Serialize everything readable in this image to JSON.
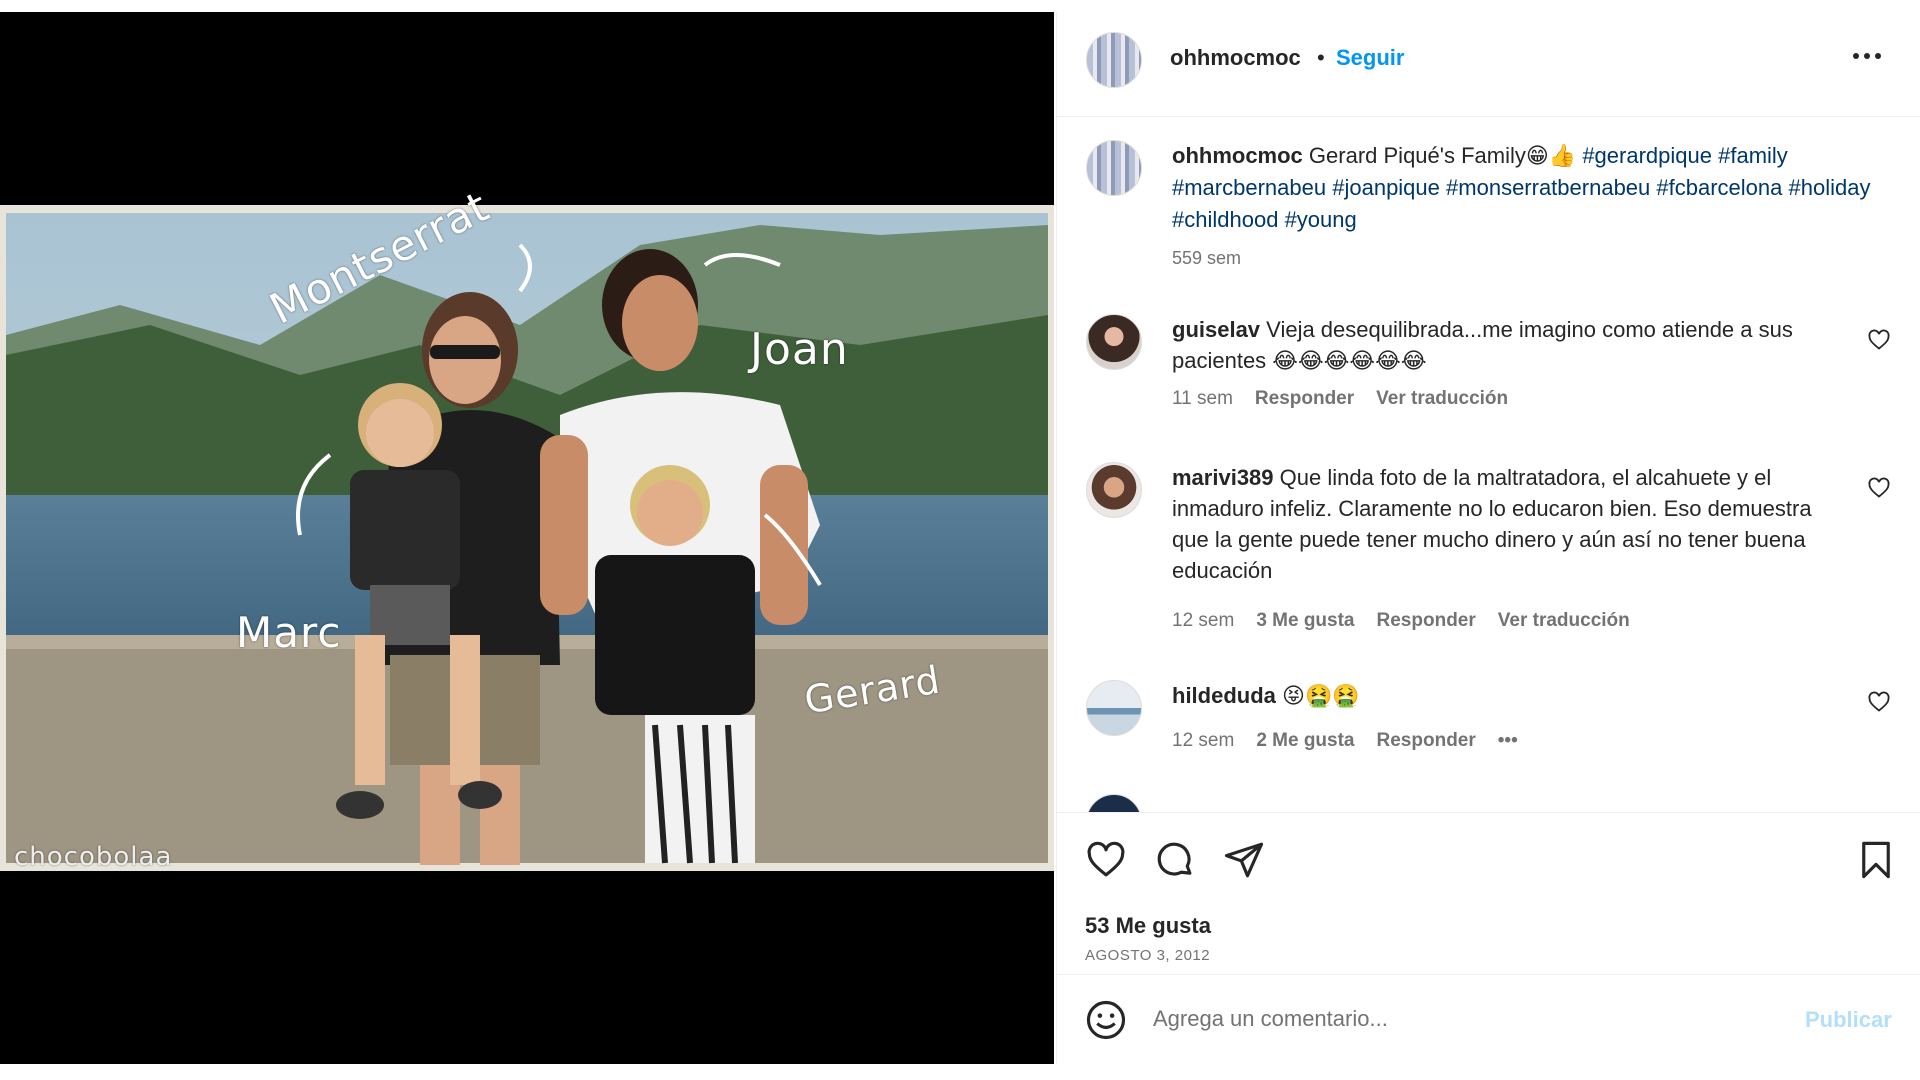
{
  "post": {
    "username": "ohhmocmoc",
    "dot": "•",
    "follow_label": "Seguir",
    "more_icon": "more-horizontal-icon"
  },
  "photo": {
    "labels": {
      "montserrat": "Montserrat",
      "joan": "Joan",
      "marc": "Marc",
      "gerard": "Gerard"
    },
    "watermark": "chocobolaa"
  },
  "caption": {
    "username": "ohhmocmoc",
    "text": "Gerard Piqué's Family😁👍",
    "hashtags": [
      "#gerardpique",
      "#family",
      "#marcbernabeu",
      "#joanpique",
      "#monserratbernabeu",
      "#fcbarcelona",
      "#holiday",
      "#childhood",
      "#young"
    ],
    "time": "559 sem"
  },
  "comments": [
    {
      "username": "guiselav",
      "text": "Vieja desequilibrada...me imagino como atiende a sus pacientes 😂😂😂😂😂😂",
      "time": "11 sem",
      "reply": "Responder",
      "translate": "Ver traducción"
    },
    {
      "username": "marivi389",
      "text": "Que linda foto de la maltratadora, el alcahuete y el inmaduro infeliz. Claramente no lo educaron bien. Eso demuestra que la gente puede tener mucho dinero y aún así no tener buena educación",
      "time": "12 sem",
      "likes": "3 Me gusta",
      "reply": "Responder",
      "translate": "Ver traducción"
    },
    {
      "username": "hildeduda",
      "text": "😝🤮🤮",
      "time": "12 sem",
      "likes": "2 Me gusta",
      "reply": "Responder",
      "more": "•••"
    }
  ],
  "actions": {
    "likes": "53 Me gusta",
    "date": "AGOSTO 3, 2012"
  },
  "composer": {
    "placeholder": "Agrega un comentario...",
    "publish": "Publicar"
  },
  "colors": {
    "accent": "#0095f6",
    "hashtag": "#00376b",
    "muted": "#737373",
    "publish_disabled": "#b2dffc"
  }
}
